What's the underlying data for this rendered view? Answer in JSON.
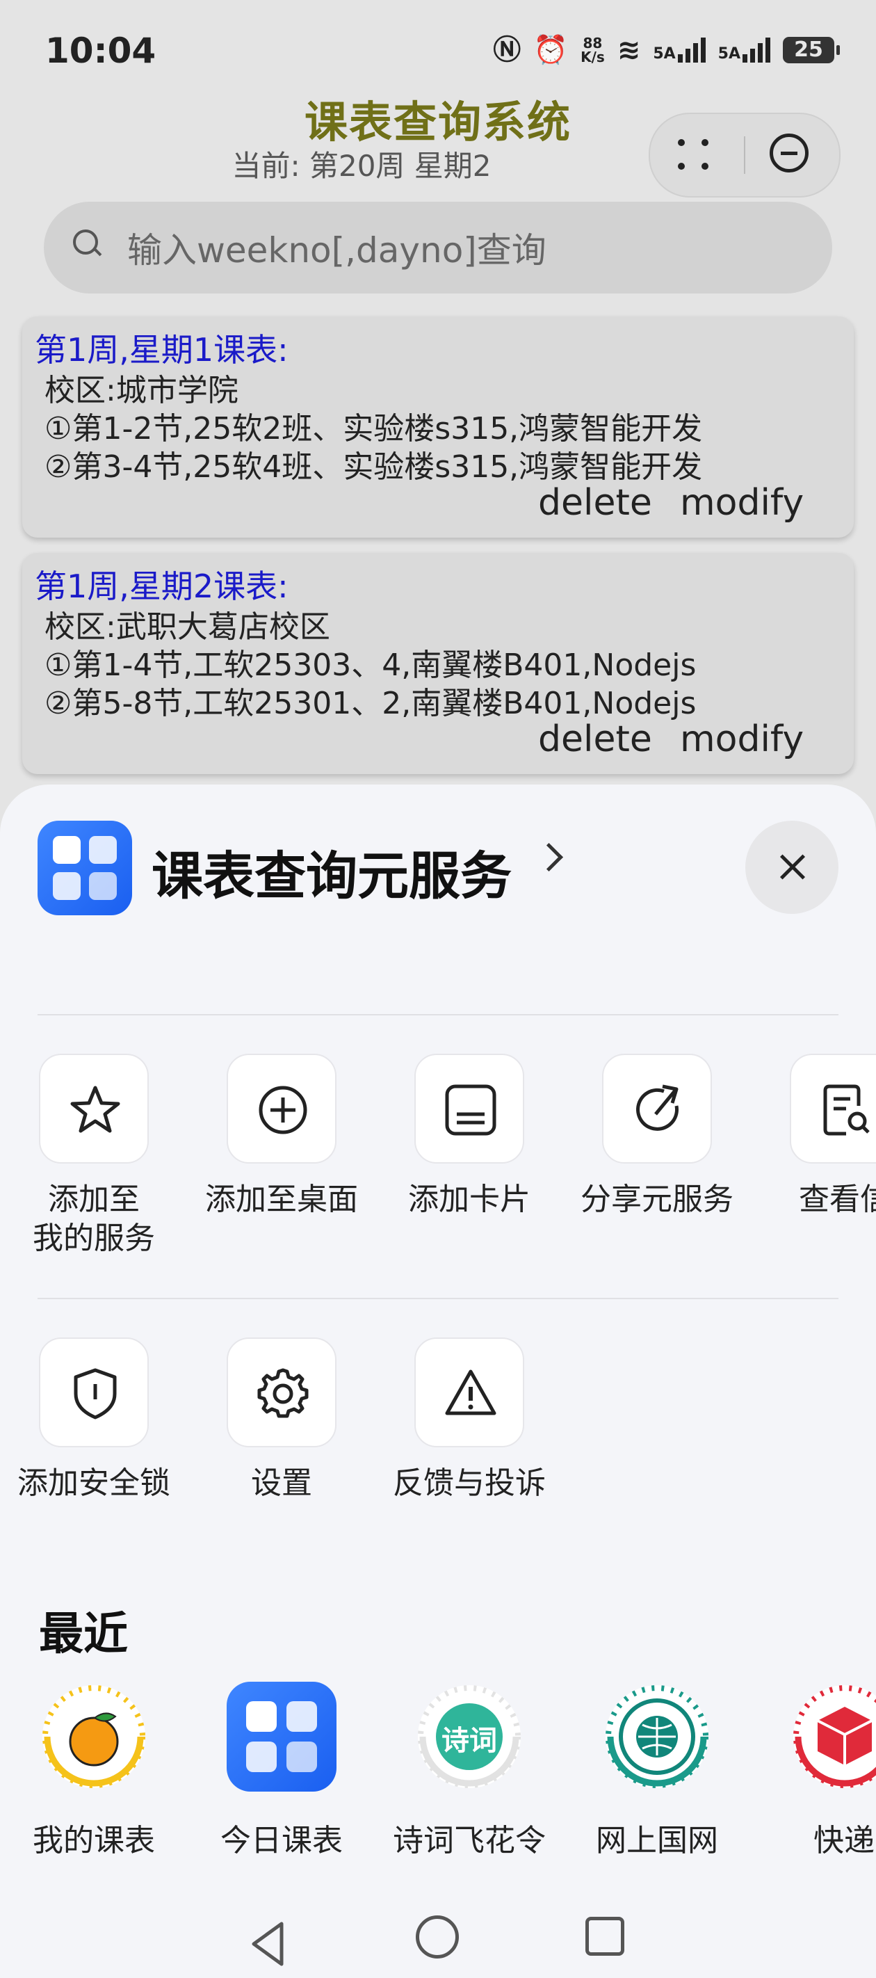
{
  "status": {
    "time": "10:04",
    "speed_top": "88",
    "speed_unit": "K/s",
    "signal1": "5A",
    "signal2": "5A",
    "battery": "25"
  },
  "app": {
    "title": "课表查询系统",
    "subtitle": "当前: 第20周 星期2",
    "search_placeholder": "输入weekno[,dayno]查询"
  },
  "cards": [
    {
      "title": "第1周,星期1课表:",
      "campus": "校区:城市学院",
      "line1": "①第1-2节,25软2班、实验楼s315,鸿蒙智能开发",
      "line2": "②第3-4节,25软4班、实验楼s315,鸿蒙智能开发",
      "delete": "delete",
      "modify": "modify"
    },
    {
      "title": "第1周,星期2课表:",
      "campus": "校区:武职大葛店校区",
      "line1": "①第1-4节,工软25303、4,南翼楼B401,Nodejs",
      "line2": "②第5-8节,工软25301、2,南翼楼B401,Nodejs",
      "delete": "delete",
      "modify": "modify"
    }
  ],
  "sheet": {
    "title": "课表查询元服务",
    "actions_row1": [
      {
        "label_line1": "添加至",
        "label_line2": "我的服务",
        "icon": "star-icon"
      },
      {
        "label_line1": "添加至桌面",
        "label_line2": "",
        "icon": "add-circle-icon"
      },
      {
        "label_line1": "添加卡片",
        "label_line2": "",
        "icon": "card-icon"
      },
      {
        "label_line1": "分享元服务",
        "label_line2": "",
        "icon": "share-icon"
      },
      {
        "label_line1": "查看信",
        "label_line2": "",
        "icon": "document-search-icon"
      }
    ],
    "actions_row2": [
      {
        "label_line1": "添加安全锁",
        "icon": "shield-icon"
      },
      {
        "label_line1": "设置",
        "icon": "gear-icon"
      },
      {
        "label_line1": "反馈与投诉",
        "icon": "warning-icon"
      }
    ],
    "recent_title": "最近",
    "recent_apps": [
      {
        "label": "我的课表",
        "icon": "orange-icon"
      },
      {
        "label": "今日课表",
        "icon": "grid-app-icon"
      },
      {
        "label": "诗词飞花令",
        "icon": "poetry-icon",
        "badge": "诗词"
      },
      {
        "label": "网上国网",
        "icon": "state-grid-icon"
      },
      {
        "label": "快递",
        "icon": "package-icon"
      }
    ]
  }
}
